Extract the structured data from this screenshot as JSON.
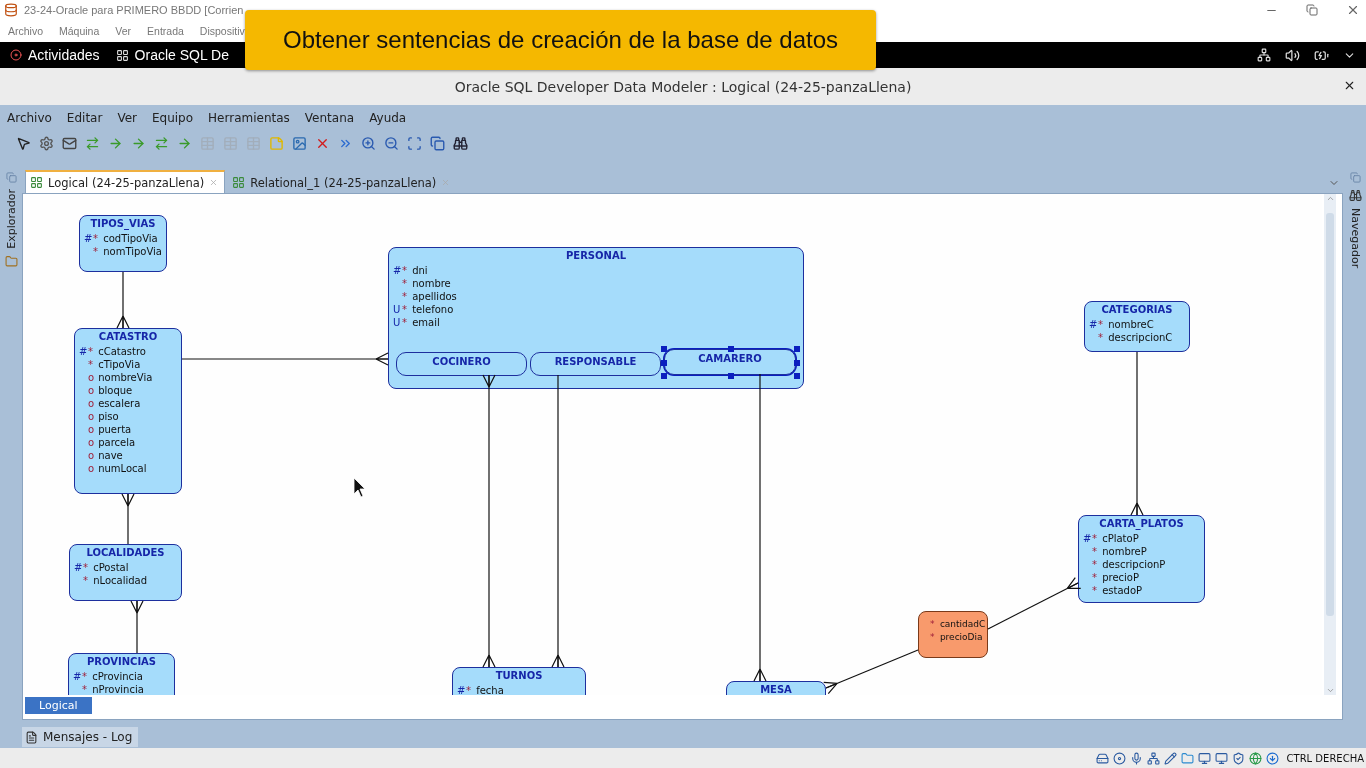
{
  "vm_window": {
    "title": "23-24-Oracle para PRIMERO BBDD [Corrien",
    "menu": [
      "Archivo",
      "Máquina",
      "Ver",
      "Entrada",
      "Dispositiv"
    ]
  },
  "overlay_banner": {
    "text": "Obtener sentencias de creación de la base de datos"
  },
  "top_bar": {
    "activities": "Actividades",
    "app": "Oracle SQL De"
  },
  "app_window": {
    "title": "Oracle SQL Developer Data Modeler : Logical (24-25-panzaLlena)"
  },
  "menu": [
    "Archivo",
    "Editar",
    "Ver",
    "Equipo",
    "Herramientas",
    "Ventana",
    "Ayuda"
  ],
  "toolbar": [
    {
      "disabled": false
    },
    {
      "disabled": false
    },
    {
      "disabled": false
    },
    {
      "disabled": false
    },
    {
      "disabled": false
    },
    {
      "disabled": false
    },
    {
      "disabled": false
    },
    {
      "disabled": false
    },
    {
      "disabled": true
    },
    {
      "disabled": true
    },
    {
      "disabled": true
    },
    {
      "disabled": false
    },
    {
      "disabled": false
    },
    {
      "disabled": false
    },
    {
      "disabled": false
    },
    {
      "disabled": false
    },
    {
      "disabled": false
    },
    {
      "disabled": false
    },
    {
      "disabled": false
    },
    {
      "disabled": false
    }
  ],
  "side_panels": {
    "left": "Explorador",
    "right": "Navegador"
  },
  "tabs": [
    {
      "label": "Logical (24-25-panzaLlena)",
      "selected": true
    },
    {
      "label": "Relational_1 (24-25-panzaLlena)",
      "selected": false
    }
  ],
  "diagram": {
    "entities": [
      {
        "kind": "entity",
        "name": "TIPOS_VIAS",
        "attributes": [
          {
            "key": "#",
            "flag": "*",
            "name": "codTipoVia"
          },
          {
            "flag": "*",
            "name": "nomTipoVia"
          }
        ]
      },
      {
        "kind": "entity",
        "name": "CATASTRO",
        "attributes": [
          {
            "key": "#",
            "flag": "*",
            "name": "cCatastro"
          },
          {
            "flag": "*",
            "name": "cTipoVia"
          },
          {
            "flag": "o",
            "name": "nombreVia"
          },
          {
            "flag": "o",
            "name": "bloque"
          },
          {
            "flag": "o",
            "name": "escalera"
          },
          {
            "flag": "o",
            "name": "piso"
          },
          {
            "flag": "o",
            "name": "puerta"
          },
          {
            "flag": "o",
            "name": "parcela"
          },
          {
            "flag": "o",
            "name": "nave"
          },
          {
            "flag": "o",
            "name": "numLocal"
          }
        ]
      },
      {
        "kind": "entity",
        "name": "LOCALIDADES",
        "attributes": [
          {
            "key": "#",
            "flag": "*",
            "name": "cPostal"
          },
          {
            "flag": "*",
            "name": "nLocalidad"
          }
        ]
      },
      {
        "kind": "entity",
        "name": "PROVINCIAS",
        "attributes": [
          {
            "key": "#",
            "flag": "*",
            "name": "cProvincia"
          },
          {
            "flag": "*",
            "name": "nProvincia"
          }
        ]
      },
      {
        "kind": "entity",
        "name": "PERSONAL",
        "attributes": [
          {
            "key": "#",
            "flag": "*",
            "name": "dni"
          },
          {
            "flag": "*",
            "name": "nombre"
          },
          {
            "flag": "*",
            "name": "apellidos"
          },
          {
            "key": "U",
            "flag": "*",
            "name": "telefono"
          },
          {
            "key": "U",
            "flag": "*",
            "name": "email"
          }
        ],
        "subtypes": [
          {
            "name": "COCINERO",
            "selected": false
          },
          {
            "name": "RESPONSABLE",
            "selected": false
          },
          {
            "name": "CAMARERO",
            "selected": true
          }
        ]
      },
      {
        "kind": "entity",
        "name": "CATEGORIAS",
        "attributes": [
          {
            "key": "#",
            "flag": "*",
            "name": "nombreC"
          },
          {
            "flag": "*",
            "name": "descripcionC"
          }
        ]
      },
      {
        "kind": "entity",
        "name": "CARTA_PLATOS",
        "attributes": [
          {
            "key": "#",
            "flag": "*",
            "name": "cPlatoP"
          },
          {
            "flag": "*",
            "name": "nombreP"
          },
          {
            "flag": "*",
            "name": "descripcionP"
          },
          {
            "flag": "*",
            "name": "precioP"
          },
          {
            "flag": "*",
            "name": "estadoP"
          }
        ]
      },
      {
        "kind": "association",
        "attributes": [
          {
            "flag": "*",
            "name": "cantidadC"
          },
          {
            "flag": "*",
            "name": "precioDia"
          }
        ]
      },
      {
        "kind": "entity",
        "name": "TURNOS",
        "attributes": [
          {
            "key": "#",
            "flag": "*",
            "name": "fecha"
          }
        ]
      },
      {
        "kind": "entity",
        "name": "MESA"
      }
    ],
    "view_tab": {
      "label": "Logical",
      "selected": true
    }
  },
  "log_panel": {
    "label": "Mensajes - Log"
  },
  "status_bar": {
    "host_key": "CTRL DERECHA"
  }
}
